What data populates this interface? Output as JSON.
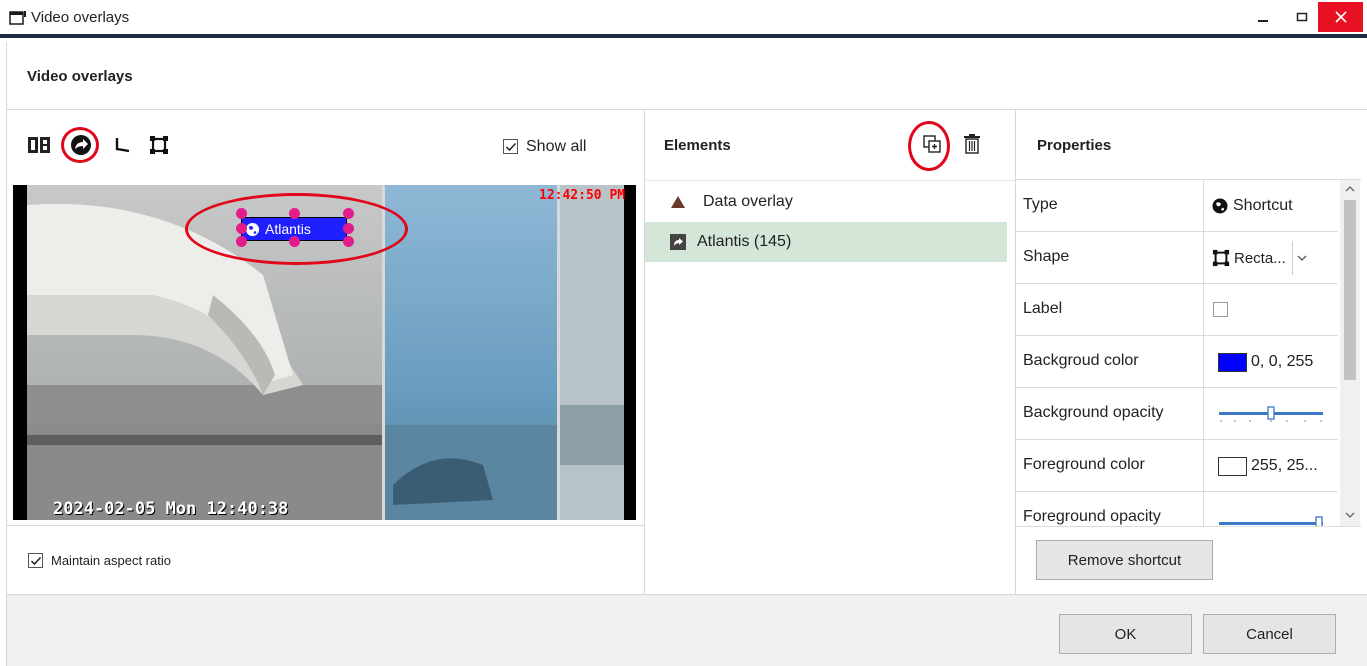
{
  "window": {
    "title": "Video overlays",
    "heading": "Video overlays"
  },
  "toolbar": {
    "show_all_label": "Show all",
    "show_all_checked": true
  },
  "video": {
    "timestamp_top": "12:42:50 PM",
    "timestamp_bottom": "2024-02-05 Mon 12:40:38",
    "overlay_label": "Atlantis"
  },
  "maintain_aspect_ratio": {
    "label": "Maintain aspect ratio",
    "checked": true
  },
  "elements": {
    "heading": "Elements",
    "items": [
      {
        "label": "Data overlay",
        "icon": "data-overlay-icon",
        "selected": false
      },
      {
        "label": "Atlantis (145)",
        "icon": "shortcut-icon",
        "selected": true
      }
    ]
  },
  "properties": {
    "heading": "Properties",
    "rows": [
      {
        "name": "Type",
        "value": "Shortcut",
        "icon": "globe-icon"
      },
      {
        "name": "Shape",
        "value": "Recta...",
        "icon": "rectangle-shape-icon"
      },
      {
        "name": "Label",
        "value": ""
      },
      {
        "name": "Backgroud color",
        "value": "0, 0, 255",
        "swatch": "#0000ff"
      },
      {
        "name": "Background opacity",
        "value": "",
        "level": 0.5
      },
      {
        "name": "Foreground color",
        "value": "255, 25...",
        "swatch": "#ffffff"
      },
      {
        "name": "Foreground opacity",
        "value": "",
        "level": 1.0
      }
    ],
    "remove_button": "Remove shortcut"
  },
  "footer": {
    "ok": "OK",
    "cancel": "Cancel"
  },
  "colors": {
    "accent_ring": "#e2061a",
    "selection": "#d4e6d8",
    "overlay_bg": "#0000ff",
    "handle": "#e21c8b"
  }
}
